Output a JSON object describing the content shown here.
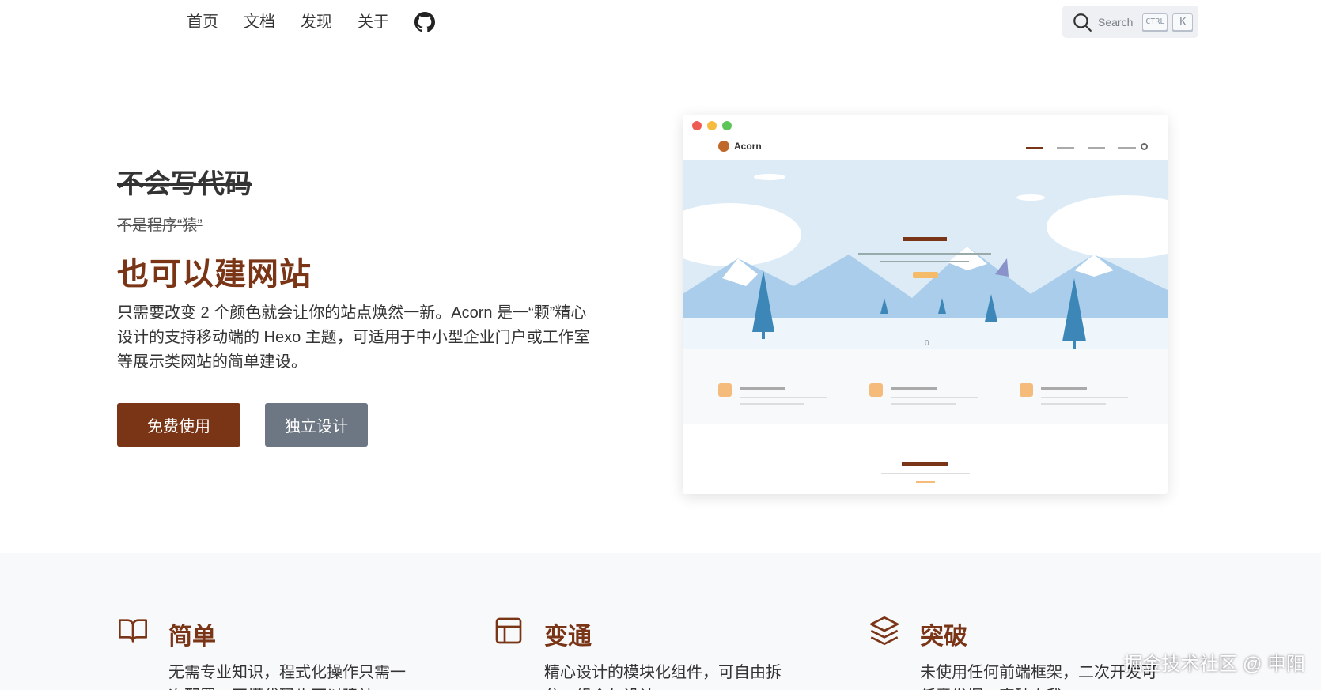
{
  "nav": {
    "items": [
      "首页",
      "文档",
      "发现",
      "关于"
    ],
    "github_icon": "github-icon"
  },
  "search": {
    "placeholder": "Search",
    "key_ctrl": "CTRL",
    "key_k": "K"
  },
  "hero": {
    "strike_title": "不会写代码",
    "strike_sub": "不是程序“猿”",
    "title": "也可以建网站",
    "description": "只需要改变 2 个颜色就会让你的站点焕然一新。Acorn 是一“颗”精心设计的支持移动端的 Hexo 主题，可适用于中小型企业门户或工作室等展示类网站的简单建设。",
    "primary_button": "免费使用",
    "secondary_button": "独立设计"
  },
  "preview": {
    "brand": "Acorn",
    "counter": "0"
  },
  "features": [
    {
      "icon": "book-open-icon",
      "title": "简单",
      "desc": "无需专业知识，程式化操作只需一次配置，不懂代码也可以建站。"
    },
    {
      "icon": "layout-icon",
      "title": "变通",
      "desc": "精心设计的模块化组件，可自由拆分、组合与设计。"
    },
    {
      "icon": "layers-icon",
      "title": "突破",
      "desc": "未使用任何前端框架，二次开发可任意发挥，突破自我。"
    }
  ],
  "watermark": "掘金技术社区 @ 申阳",
  "colors": {
    "accent": "#7a3416",
    "secondary": "#6c7783",
    "feature_bg": "#f8f9fb"
  }
}
